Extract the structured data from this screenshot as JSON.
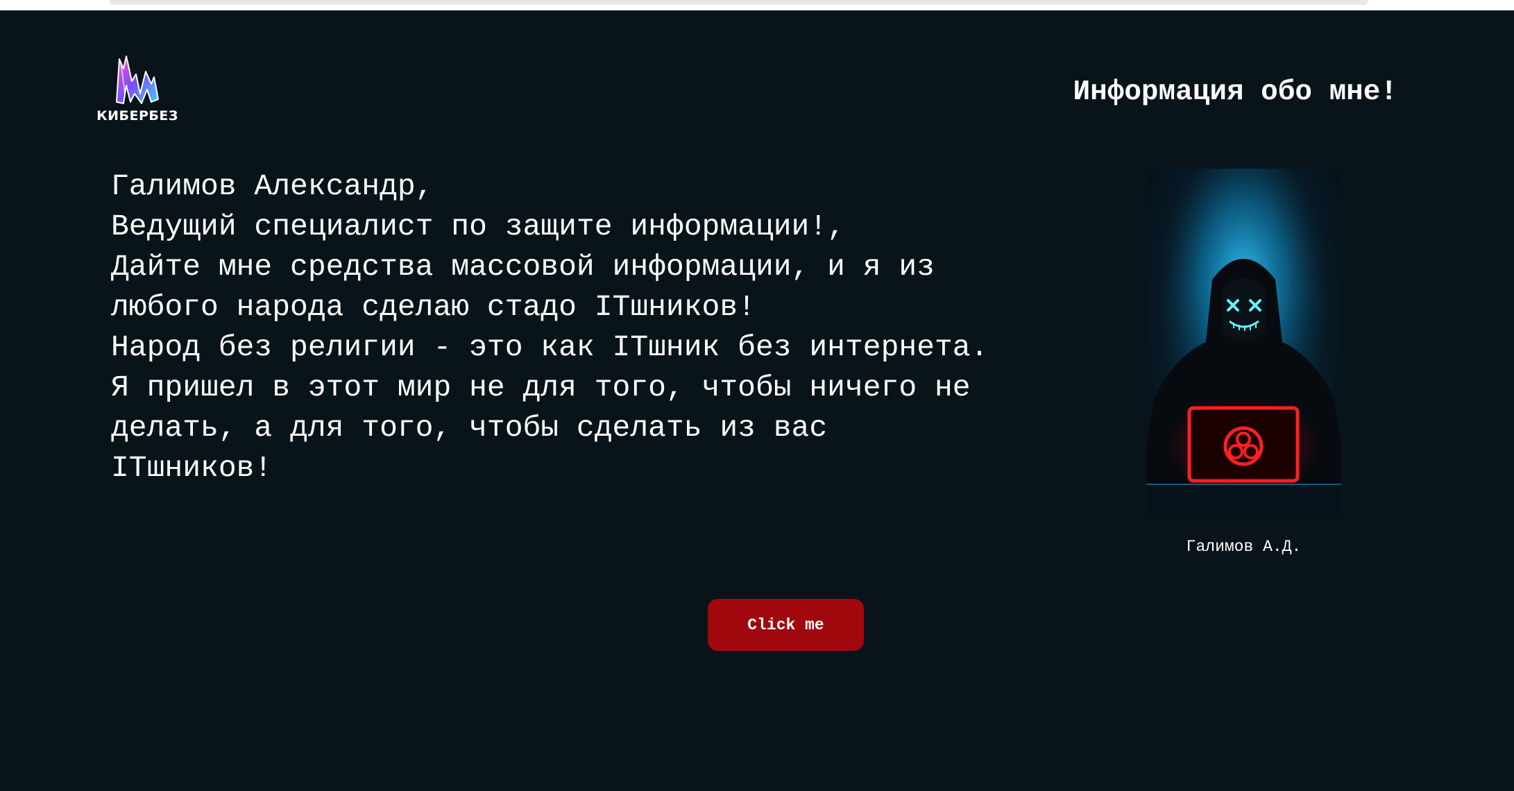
{
  "header": {
    "logo_text": "КИБЕРБЕЗ",
    "title": "Информация обо мне!"
  },
  "bio": {
    "lines": [
      "Галимов Александр,",
      "Ведущий специалист по защите информации!,",
      "Дайте мне средства массовой информации, и я из любого народа сделаю стадо ITшников!",
      "Народ без религии - это как ITшник без интернета.",
      "Я пришел в этот мир не для того, чтобы ничего не делать, а для того, чтобы сделать из вас ITшников!"
    ]
  },
  "photo": {
    "caption": "Галимов А.Д.",
    "icon": "hooded-hacker-illustration"
  },
  "button": {
    "label": "Click me"
  },
  "colors": {
    "background": "#081419",
    "text": "#ffffff",
    "button": "#a1080e",
    "logo_gradient": [
      "#ff4fc8",
      "#7a4dff",
      "#3fd2ff"
    ]
  }
}
